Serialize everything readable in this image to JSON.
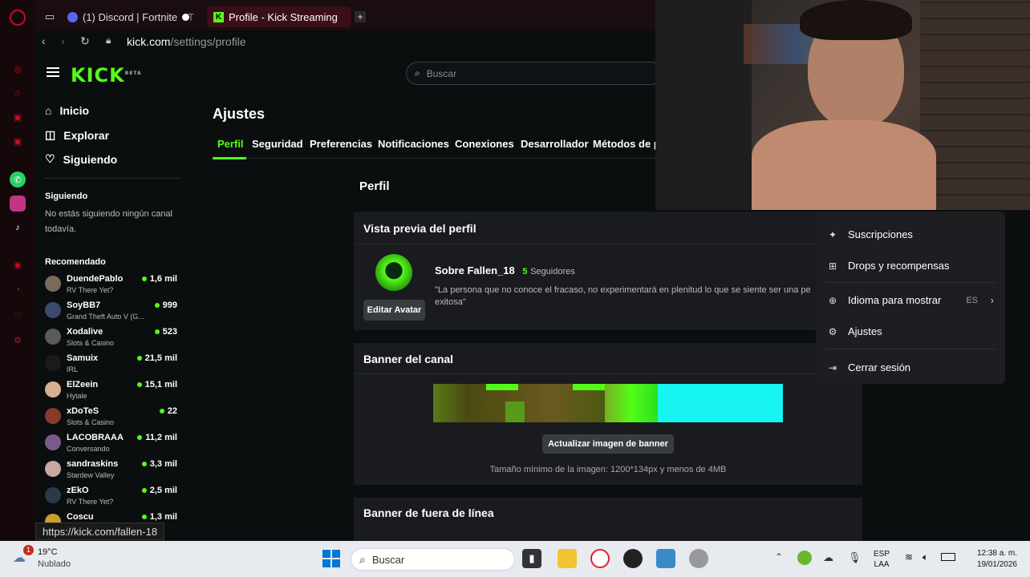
{
  "browser": {
    "tabs": [
      {
        "label": "(1) Discord | Fortnite"
      },
      {
        "label": "T"
      },
      {
        "label": "Profile - Kick Streaming"
      }
    ],
    "new_tab": "+",
    "url_host": "kick.com",
    "url_path": "/settings/profile",
    "status_url": "https://kick.com/fallen-18"
  },
  "header": {
    "logo": "KICK",
    "logo_tag": "BETA",
    "search_placeholder": "Buscar"
  },
  "sidebar": {
    "nav": [
      {
        "label": "Inicio",
        "icon": "home-icon"
      },
      {
        "label": "Explorar",
        "icon": "compass-icon"
      },
      {
        "label": "Siguiendo",
        "icon": "heart-icon"
      }
    ],
    "following_title": "Siguiendo",
    "following_empty": "No estás siguiendo ningún canal todavía.",
    "recommended_title": "Recomendado",
    "recommended": [
      {
        "name": "DuendePablo",
        "game": "RV There Yet?",
        "viewers": "1,6 mil",
        "color": "#7a6a5a"
      },
      {
        "name": "SoyBB7",
        "game": "Grand Theft Auto V (G...",
        "viewers": "999",
        "color": "#3a4a6a"
      },
      {
        "name": "Xodalive",
        "game": "Slots & Casino",
        "viewers": "523",
        "color": "#5a5a5a"
      },
      {
        "name": "Samuix",
        "game": "IRL",
        "viewers": "21,5 mil",
        "color": "#1a1a1a"
      },
      {
        "name": "ElZeein",
        "game": "Hytale",
        "viewers": "15,1 mil",
        "color": "#d8b090"
      },
      {
        "name": "xDoTeS",
        "game": "Slots & Casino",
        "viewers": "22",
        "color": "#8a3a2a"
      },
      {
        "name": "LACOBRAAA",
        "game": "Conversando",
        "viewers": "11,2 mil",
        "color": "#7a5a8a"
      },
      {
        "name": "sandraskins",
        "game": "Stardew Valley",
        "viewers": "3,3 mil",
        "color": "#c8a8a0"
      },
      {
        "name": "zEkO",
        "game": "RV There Yet?",
        "viewers": "2,5 mil",
        "color": "#2a3a4a"
      },
      {
        "name": "Coscu",
        "game": "",
        "viewers": "1,3 mil",
        "color": "#c8a030"
      }
    ]
  },
  "settings": {
    "title": "Ajustes",
    "tabs": [
      "Perfil",
      "Seguridad",
      "Preferencias",
      "Notificaciones",
      "Conexiones",
      "Desarrollador",
      "Métodos de p"
    ],
    "section_title": "Perfil",
    "preview": {
      "title": "Vista previa del perfil",
      "about": "Sobre Fallen_18",
      "followers_count": "5",
      "followers_label": "Seguidores",
      "bio": "\"La persona que no conoce el fracaso, no experimentará en plenitud lo que se siente ser una pe exitosa\"",
      "edit_avatar": "Editar Avatar"
    },
    "banner": {
      "title": "Banner del canal",
      "update_button": "Actualizar imagen de banner",
      "hint": "Tamaño mínimo de la imagen: 1200*134px y menos de 4MB"
    },
    "offline_banner": {
      "title": "Banner de fuera de línea"
    }
  },
  "menu": {
    "items": [
      {
        "label": "Suscripciones",
        "icon": "sparkle-icon"
      },
      {
        "label": "Drops y recompensas",
        "icon": "gift-icon"
      },
      {
        "label": "Idioma para mostrar",
        "icon": "globe-icon",
        "value": "ES"
      },
      {
        "label": "Ajustes",
        "icon": "gear-icon"
      },
      {
        "label": "Cerrar sesión",
        "icon": "logout-icon"
      }
    ]
  },
  "taskbar": {
    "weather_temp": "19°C",
    "weather_desc": "Nublado",
    "weather_badge": "1",
    "search_placeholder": "Buscar",
    "lang": "ESP",
    "lang_sub": "LAA",
    "time": "12:38 a. m.",
    "date": "19/01/2026"
  },
  "colors": {
    "accent": "#53fc18",
    "background": "#0b0e0f",
    "card": "#191b1f"
  }
}
